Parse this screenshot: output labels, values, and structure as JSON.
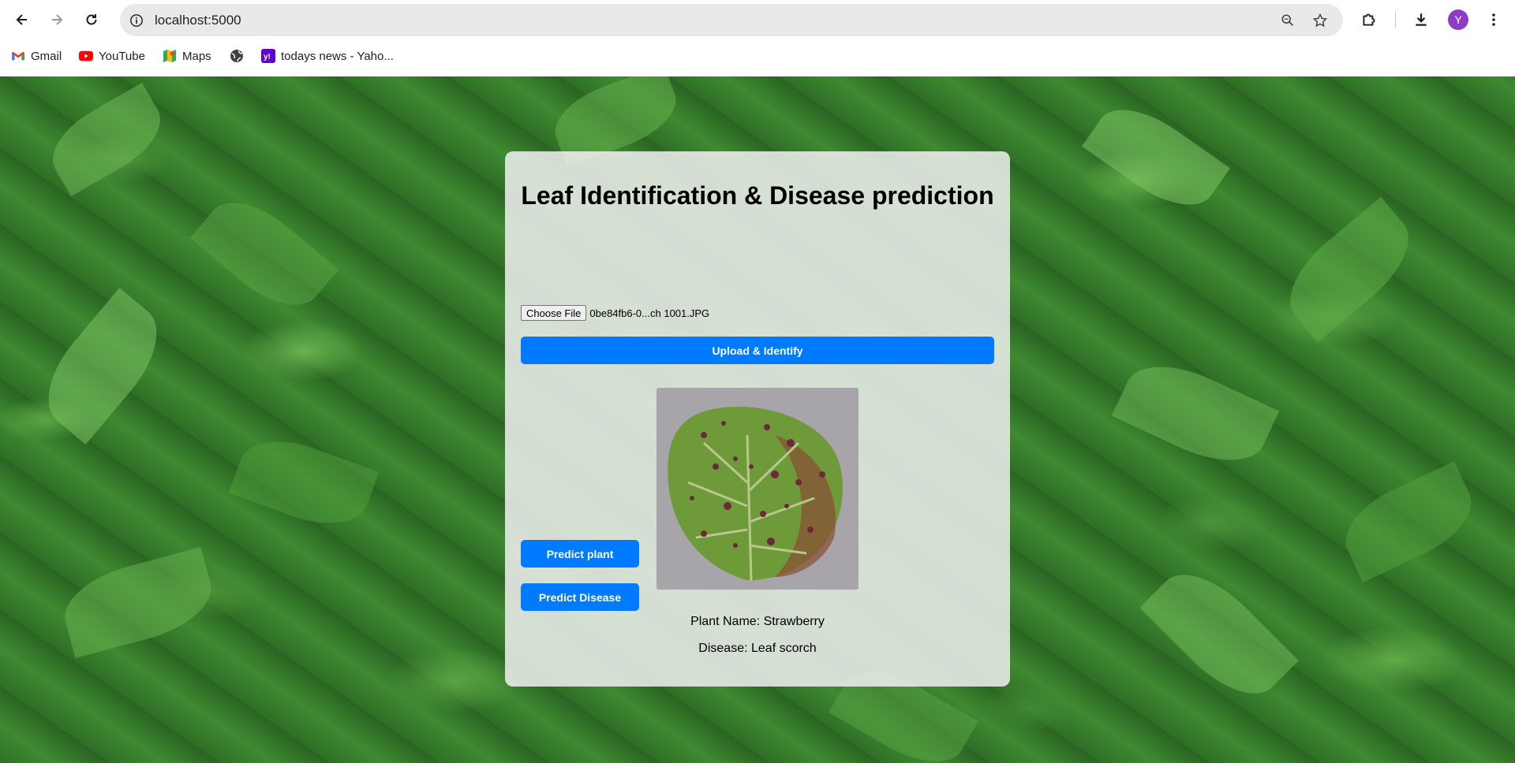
{
  "browser": {
    "url": "localhost:5000",
    "bookmarks": [
      {
        "label": "Gmail",
        "icon": "gmail-icon"
      },
      {
        "label": "YouTube",
        "icon": "youtube-icon"
      },
      {
        "label": "Maps",
        "icon": "maps-icon"
      },
      {
        "label": "",
        "icon": "globe-icon"
      },
      {
        "label": "todays news - Yaho...",
        "icon": "yahoo-icon"
      }
    ],
    "avatar_letter": "Y"
  },
  "page": {
    "title": "Leaf Identification & Disease prediction",
    "choose_file_label": "Choose File",
    "file_name": "0be84fb6-0...ch 1001.JPG",
    "upload_button": "Upload & Identify",
    "predict_plant_button": "Predict plant",
    "predict_disease_button": "Predict Disease",
    "plant_result": "Plant Name: Strawberry",
    "disease_result": "Disease: Leaf scorch"
  },
  "colors": {
    "primary_button": "#007bff",
    "leaf_background": "#2f7028"
  }
}
